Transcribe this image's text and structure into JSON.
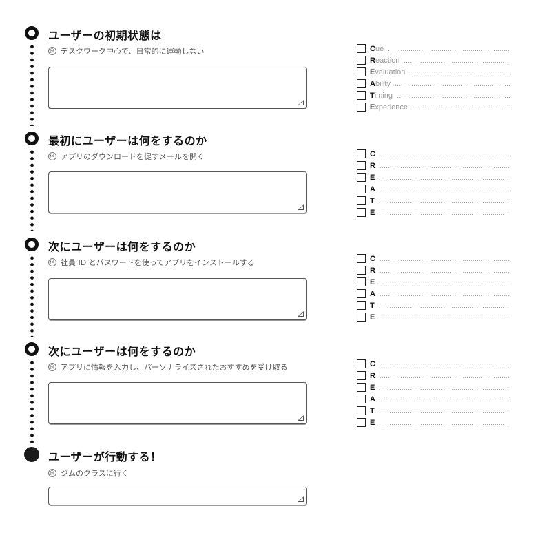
{
  "steps": [
    {
      "title": "ユーザーの初期状態は",
      "example_badge": "例",
      "example": "デスクワーク中心で、日常的に運動しない",
      "answer_value": "",
      "marker": "ring"
    },
    {
      "title": "最初にユーザーは何をするのか",
      "example_badge": "例",
      "example": "アプリのダウンロードを促すメールを開く",
      "answer_value": "",
      "marker": "ring"
    },
    {
      "title": "次にユーザーは何をするのか",
      "example_badge": "例",
      "example": "社員 ID とパスワードを使ってアプリをインストールする",
      "answer_value": "",
      "marker": "ring"
    },
    {
      "title": "次にユーザーは何をするのか",
      "example_badge": "例",
      "example": "アプリに情報を入力し、パーソナライズされたおすすめを受け取る",
      "answer_value": "",
      "marker": "ring"
    },
    {
      "title": "ユーザーが行動する！",
      "example_badge": "例",
      "example": "ジムのクラスに行く",
      "answer_value": "",
      "marker": "filled"
    }
  ],
  "checklists": [
    {
      "items": [
        {
          "initial": "C",
          "rest": "ue",
          "checked": false
        },
        {
          "initial": "R",
          "rest": "eaction",
          "checked": false
        },
        {
          "initial": "E",
          "rest": "valuation",
          "checked": false
        },
        {
          "initial": "A",
          "rest": "bility",
          "checked": false
        },
        {
          "initial": "T",
          "rest": "iming",
          "checked": false
        },
        {
          "initial": "E",
          "rest": "xperience",
          "checked": false
        }
      ]
    },
    {
      "items": [
        {
          "initial": "C",
          "rest": "",
          "checked": false
        },
        {
          "initial": "R",
          "rest": "",
          "checked": false
        },
        {
          "initial": "E",
          "rest": "",
          "checked": false
        },
        {
          "initial": "A",
          "rest": "",
          "checked": false
        },
        {
          "initial": "T",
          "rest": "",
          "checked": false
        },
        {
          "initial": "E",
          "rest": "",
          "checked": false
        }
      ]
    },
    {
      "items": [
        {
          "initial": "C",
          "rest": "",
          "checked": false
        },
        {
          "initial": "R",
          "rest": "",
          "checked": false
        },
        {
          "initial": "E",
          "rest": "",
          "checked": false
        },
        {
          "initial": "A",
          "rest": "",
          "checked": false
        },
        {
          "initial": "T",
          "rest": "",
          "checked": false
        },
        {
          "initial": "E",
          "rest": "",
          "checked": false
        }
      ]
    },
    {
      "items": [
        {
          "initial": "C",
          "rest": "",
          "checked": false
        },
        {
          "initial": "R",
          "rest": "",
          "checked": false
        },
        {
          "initial": "E",
          "rest": "",
          "checked": false
        },
        {
          "initial": "A",
          "rest": "",
          "checked": false
        },
        {
          "initial": "T",
          "rest": "",
          "checked": false
        },
        {
          "initial": "E",
          "rest": "",
          "checked": false
        }
      ]
    }
  ]
}
